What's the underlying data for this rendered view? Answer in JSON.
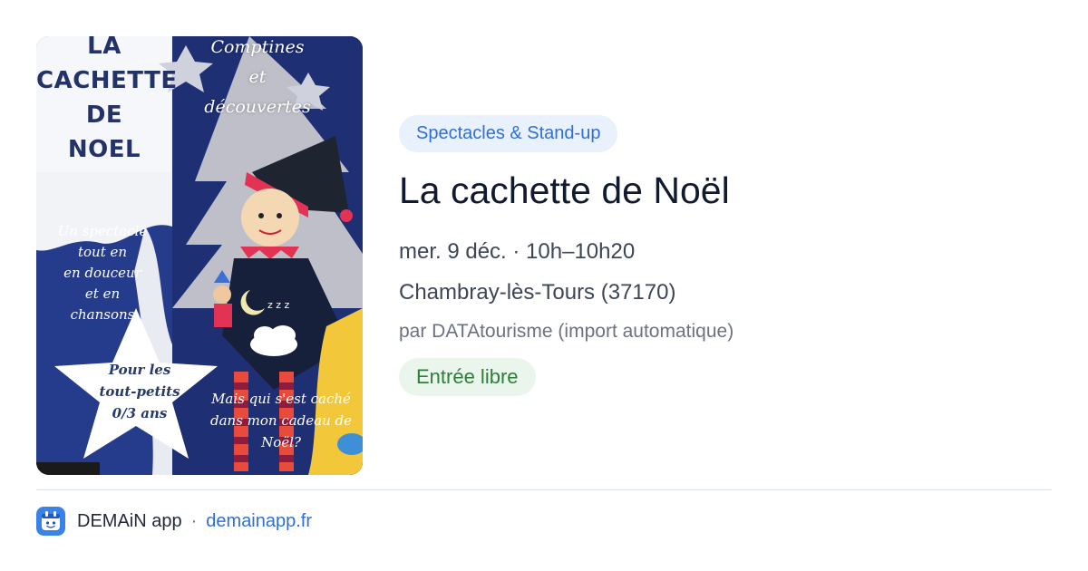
{
  "poster": {
    "title": "LA\nCACHETTE\nDE\nNOEL",
    "top_text": "Comptines\net\ndécouvertes",
    "tagline": "Un spectacle\ntout en\nen douceur\net en\nchansons",
    "star_text": "Pour les\ntout-petits\n0/3 ans",
    "question": "Mais qui s'est caché\ndans mon cadeau de\nNoël?"
  },
  "event": {
    "category": "Spectacles & Stand-up",
    "title": "La cachette de Noël",
    "datetime": "mer. 9 déc. · 10h–10h20",
    "location": "Chambray-lès-Tours (37170)",
    "source": "par DATAtourisme (import automatique)",
    "price": "Entrée libre"
  },
  "footer": {
    "app_icon": "demain-app-icon",
    "app_name": "DEMAiN app",
    "separator": "·",
    "link": "demainapp.fr"
  },
  "colors": {
    "category_text": "#2f6fd8",
    "category_bg": "#e9f1fd",
    "price_text": "#2e7d3b",
    "price_bg": "#eaf6ec",
    "link": "#2f6fd8"
  }
}
